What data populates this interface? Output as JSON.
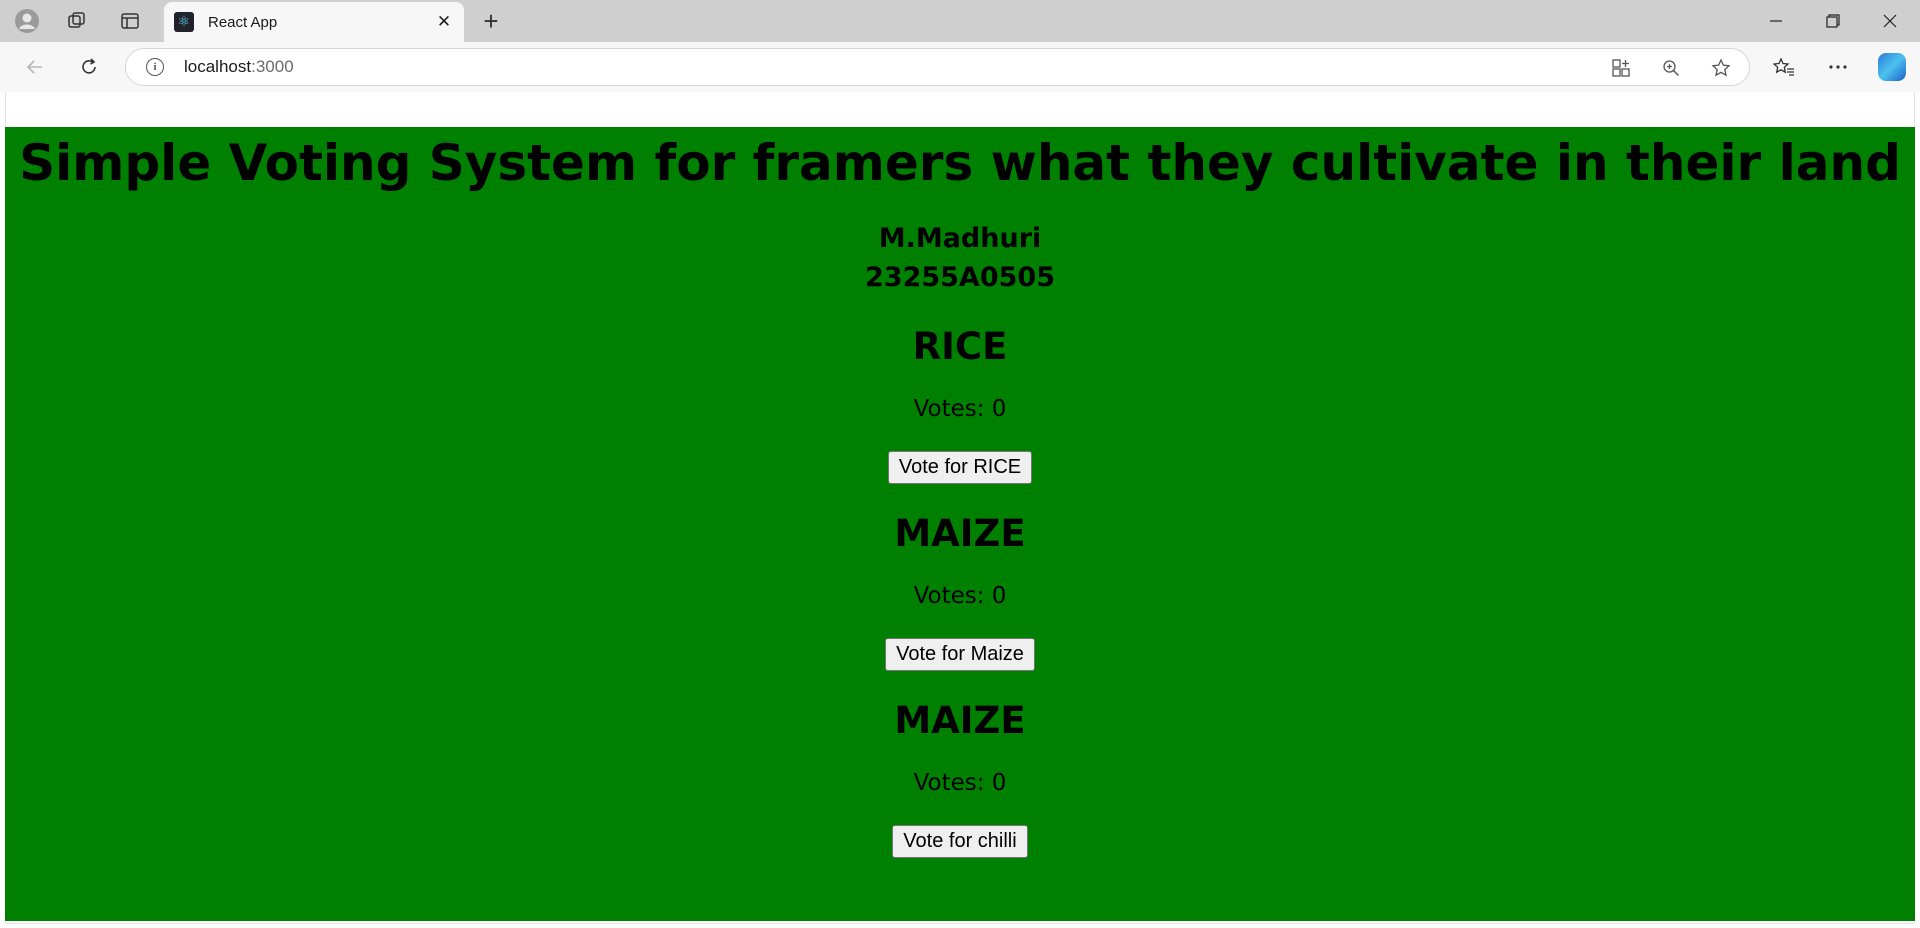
{
  "browser": {
    "tab_title": "React App",
    "tab_close": "✕",
    "new_tab": "+",
    "url_host": "localhost",
    "url_port": ":3000"
  },
  "page": {
    "title": "Simple Voting System for framers what they cultivate in their land",
    "student_name": "M.Madhuri",
    "student_id": "23255A0505",
    "crops": [
      {
        "name": "RICE",
        "votes_label": "Votes: 0",
        "button_label": "Vote for RICE"
      },
      {
        "name": "MAIZE",
        "votes_label": "Votes: 0",
        "button_label": "Vote for Maize"
      },
      {
        "name": "MAIZE",
        "votes_label": "Votes: 0",
        "button_label": "Vote for chilli"
      }
    ]
  },
  "colors": {
    "page_background": "#008000",
    "text": "#000000"
  },
  "icons": {
    "profile": "profile-icon",
    "workspaces": "workspaces-icon",
    "tab_actions": "tab-actions-icon",
    "back": "back-icon",
    "refresh": "refresh-icon",
    "site_info": "info-icon",
    "app_view": "app-view-icon",
    "zoom": "zoom-icon",
    "favorite": "star-icon",
    "favorites": "favorites-icon",
    "more": "more-icon",
    "copilot": "copilot-icon"
  }
}
